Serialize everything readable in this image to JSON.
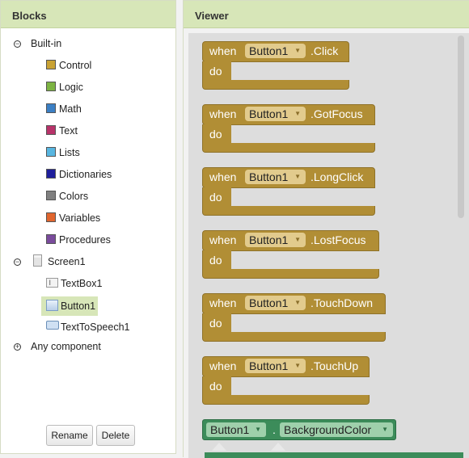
{
  "blocks_panel": {
    "title": "Blocks",
    "built_in": {
      "label": "Built-in",
      "toggle": "−",
      "items": [
        {
          "label": "Control",
          "color": "#c9a233"
        },
        {
          "label": "Logic",
          "color": "#7db443"
        },
        {
          "label": "Math",
          "color": "#3b7fc4"
        },
        {
          "label": "Text",
          "color": "#b8336a"
        },
        {
          "label": "Lists",
          "color": "#58b6e0"
        },
        {
          "label": "Dictionaries",
          "color": "#1f1f9c"
        },
        {
          "label": "Colors",
          "color": "#808080"
        },
        {
          "label": "Variables",
          "color": "#e0652e"
        },
        {
          "label": "Procedures",
          "color": "#7a4b9c"
        }
      ]
    },
    "screen": {
      "label": "Screen1",
      "toggle": "−",
      "components": [
        {
          "label": "TextBox1",
          "icon": "textbox-icon"
        },
        {
          "label": "Button1",
          "icon": "button-icon",
          "selected": true
        },
        {
          "label": "TextToSpeech1",
          "icon": "speech-icon"
        }
      ]
    },
    "any_component": {
      "label": "Any component",
      "toggle": "+"
    },
    "rename_label": "Rename",
    "delete_label": "Delete"
  },
  "viewer": {
    "title": "Viewer",
    "event_blocks": [
      {
        "when": "when",
        "component": "Button1",
        "event": ".Click",
        "do": "do"
      },
      {
        "when": "when",
        "component": "Button1",
        "event": ".GotFocus",
        "do": "do"
      },
      {
        "when": "when",
        "component": "Button1",
        "event": ".LongClick",
        "do": "do"
      },
      {
        "when": "when",
        "component": "Button1",
        "event": ".LostFocus",
        "do": "do"
      },
      {
        "when": "when",
        "component": "Button1",
        "event": ".TouchDown",
        "do": "do"
      },
      {
        "when": "when",
        "component": "Button1",
        "event": ".TouchUp",
        "do": "do"
      }
    ],
    "property_block": {
      "component": "Button1",
      "dot": ".",
      "property": "BackgroundColor"
    },
    "dropdown_arrow": "▼"
  },
  "colors": {
    "header_bg": "#d7e6b8",
    "event_block": "#b18e35",
    "property_block": "#3c8c5a"
  }
}
